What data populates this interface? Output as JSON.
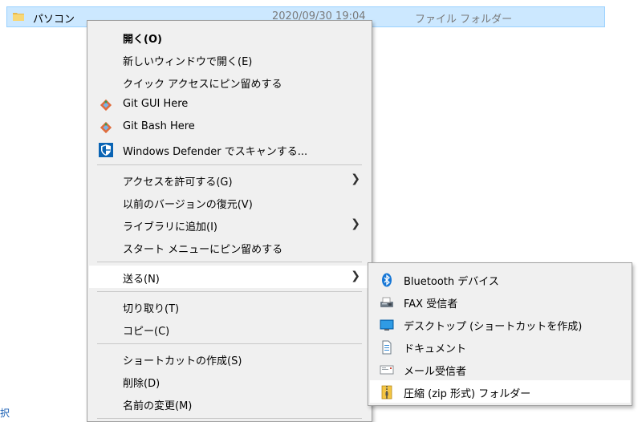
{
  "file_row": {
    "name": "パソコン",
    "date": "2020/09/30 19:04",
    "type": "ファイル フォルダー"
  },
  "edge_text": "択",
  "context_menu": {
    "items": [
      {
        "label": "開く(O)",
        "bold": true
      },
      {
        "label": "新しいウィンドウで開く(E)"
      },
      {
        "label": "クイック アクセスにピン留めする"
      },
      {
        "label": "Git GUI Here",
        "icon": "git-icon"
      },
      {
        "label": "Git Bash Here",
        "icon": "git-icon"
      },
      {
        "label": "Windows Defender でスキャンする...",
        "icon": "defender-shield-icon"
      },
      {
        "label": "アクセスを許可する(G)",
        "submenu": true
      },
      {
        "label": "以前のバージョンの復元(V)"
      },
      {
        "label": "ライブラリに追加(I)",
        "submenu": true
      },
      {
        "label": "スタート メニューにピン留めする"
      },
      {
        "label": "送る(N)",
        "submenu": true,
        "highlighted": true
      },
      {
        "label": "切り取り(T)"
      },
      {
        "label": "コピー(C)"
      },
      {
        "label": "ショートカットの作成(S)"
      },
      {
        "label": "削除(D)"
      },
      {
        "label": "名前の変更(M)"
      }
    ]
  },
  "send_to_menu": {
    "items": [
      {
        "label": "Bluetooth デバイス",
        "icon": "bluetooth-icon"
      },
      {
        "label": "FAX 受信者",
        "icon": "fax-icon"
      },
      {
        "label": "デスクトップ (ショートカットを作成)",
        "icon": "desktop-icon"
      },
      {
        "label": "ドキュメント",
        "icon": "documents-icon"
      },
      {
        "label": "メール受信者",
        "icon": "mail-icon"
      },
      {
        "label": "圧縮 (zip 形式) フォルダー",
        "icon": "zip-folder-icon",
        "highlighted": true
      }
    ]
  },
  "colors": {
    "selection_bg": "#cce8ff",
    "menu_bg": "#f0f0f0",
    "hover_bg": "#ffffff",
    "accent_blue": "#0078d7"
  }
}
